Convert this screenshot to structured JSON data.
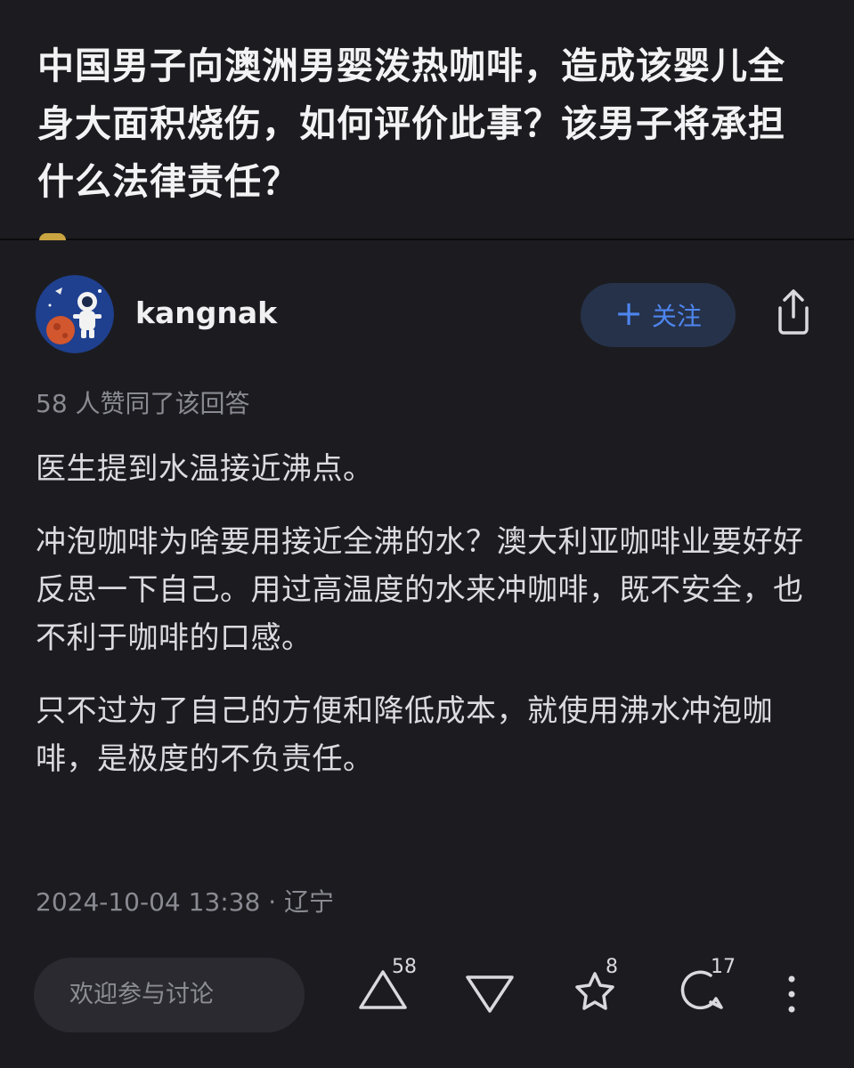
{
  "question": {
    "title": "中国男子向澳洲男婴泼热咖啡，造成该婴儿全身大面积烧伤，如何评价此事？该男子将承担什么法律责任？"
  },
  "author": {
    "name": "kangnak",
    "follow_label": "关注"
  },
  "answer": {
    "upvote_summary": "58 人赞同了该回答",
    "paragraphs": [
      "医生提到水温接近沸点。",
      "冲泡咖啡为啥要用接近全沸的水？澳大利亚咖啡业要好好反思一下自己。用过高温度的水来冲咖啡，既不安全，也不利于咖啡的口感。",
      "只不过为了自己的方便和降低成本，就使用沸水冲泡咖啡，是极度的不负责任。"
    ],
    "meta": "2024-10-04 13:38 · 辽宁"
  },
  "bottom_bar": {
    "comment_placeholder": "欢迎参与讨论",
    "upvote_count": "58",
    "favorite_count": "8",
    "comment_count": "17"
  },
  "colors": {
    "background": "#1c1c20",
    "accent": "#4e86f0",
    "follow_bg": "#26324a",
    "muted_text": "#8a8a92"
  },
  "icons": [
    "plus-icon",
    "share-icon",
    "upvote-icon",
    "downvote-icon",
    "star-icon",
    "comment-icon",
    "more-icon"
  ]
}
